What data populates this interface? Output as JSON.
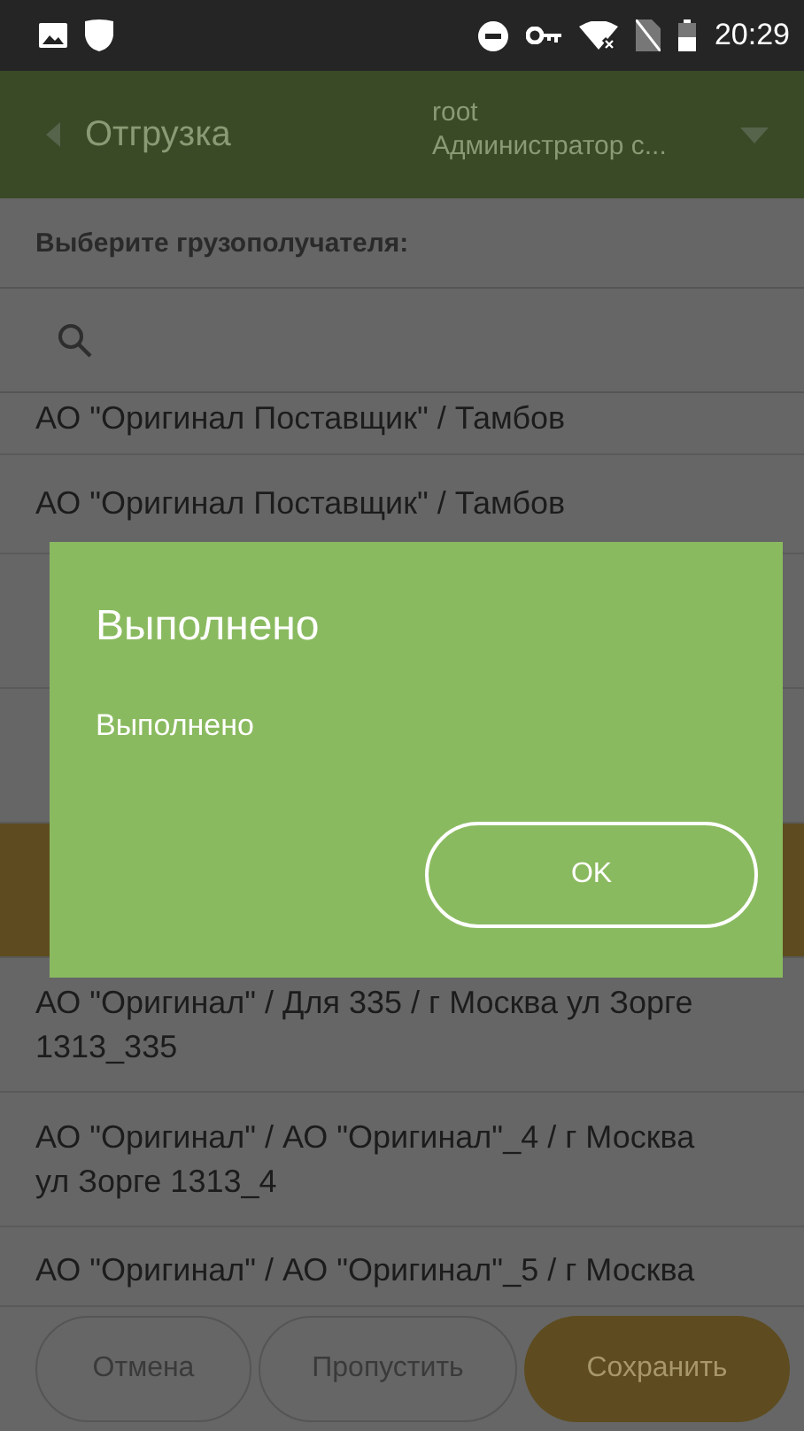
{
  "status_bar": {
    "time": "20:29"
  },
  "header": {
    "back_label": "Отгрузка",
    "user": "root",
    "role": "Администратор с..."
  },
  "prompt": "Выберите грузополучателя:",
  "list": [
    {
      "lines": [
        "АО \"Оригинал Поставщик\" / Тамбов"
      ],
      "selected": false
    },
    {
      "lines": [
        "АО \"Оригинал Поставщик\" / Тамбов"
      ],
      "selected": false
    },
    {
      "selected": false
    },
    {
      "selected": false
    },
    {
      "selected": true
    },
    {
      "lines": [
        "АО \"Оригинал\" / Для 335 / г Москва ул Зорге",
        "1313_335"
      ],
      "selected": false
    },
    {
      "lines": [
        "АО \"Оригинал\" / АО \"Оригинал\"_4 / г Москва",
        "ул Зорге 1313_4"
      ],
      "selected": false
    },
    {
      "lines": [
        "АО \"Оригинал\" / АО \"Оригинал\"_5 / г Москва"
      ],
      "selected": false
    }
  ],
  "buttons": [
    {
      "label": "Отмена",
      "kind": "outline"
    },
    {
      "label": "Пропустить",
      "kind": "outline"
    },
    {
      "label": "Сохранить",
      "kind": "primary"
    }
  ],
  "dialog": {
    "title": "Выполнено",
    "message": "Выполнено",
    "button": "OK"
  }
}
